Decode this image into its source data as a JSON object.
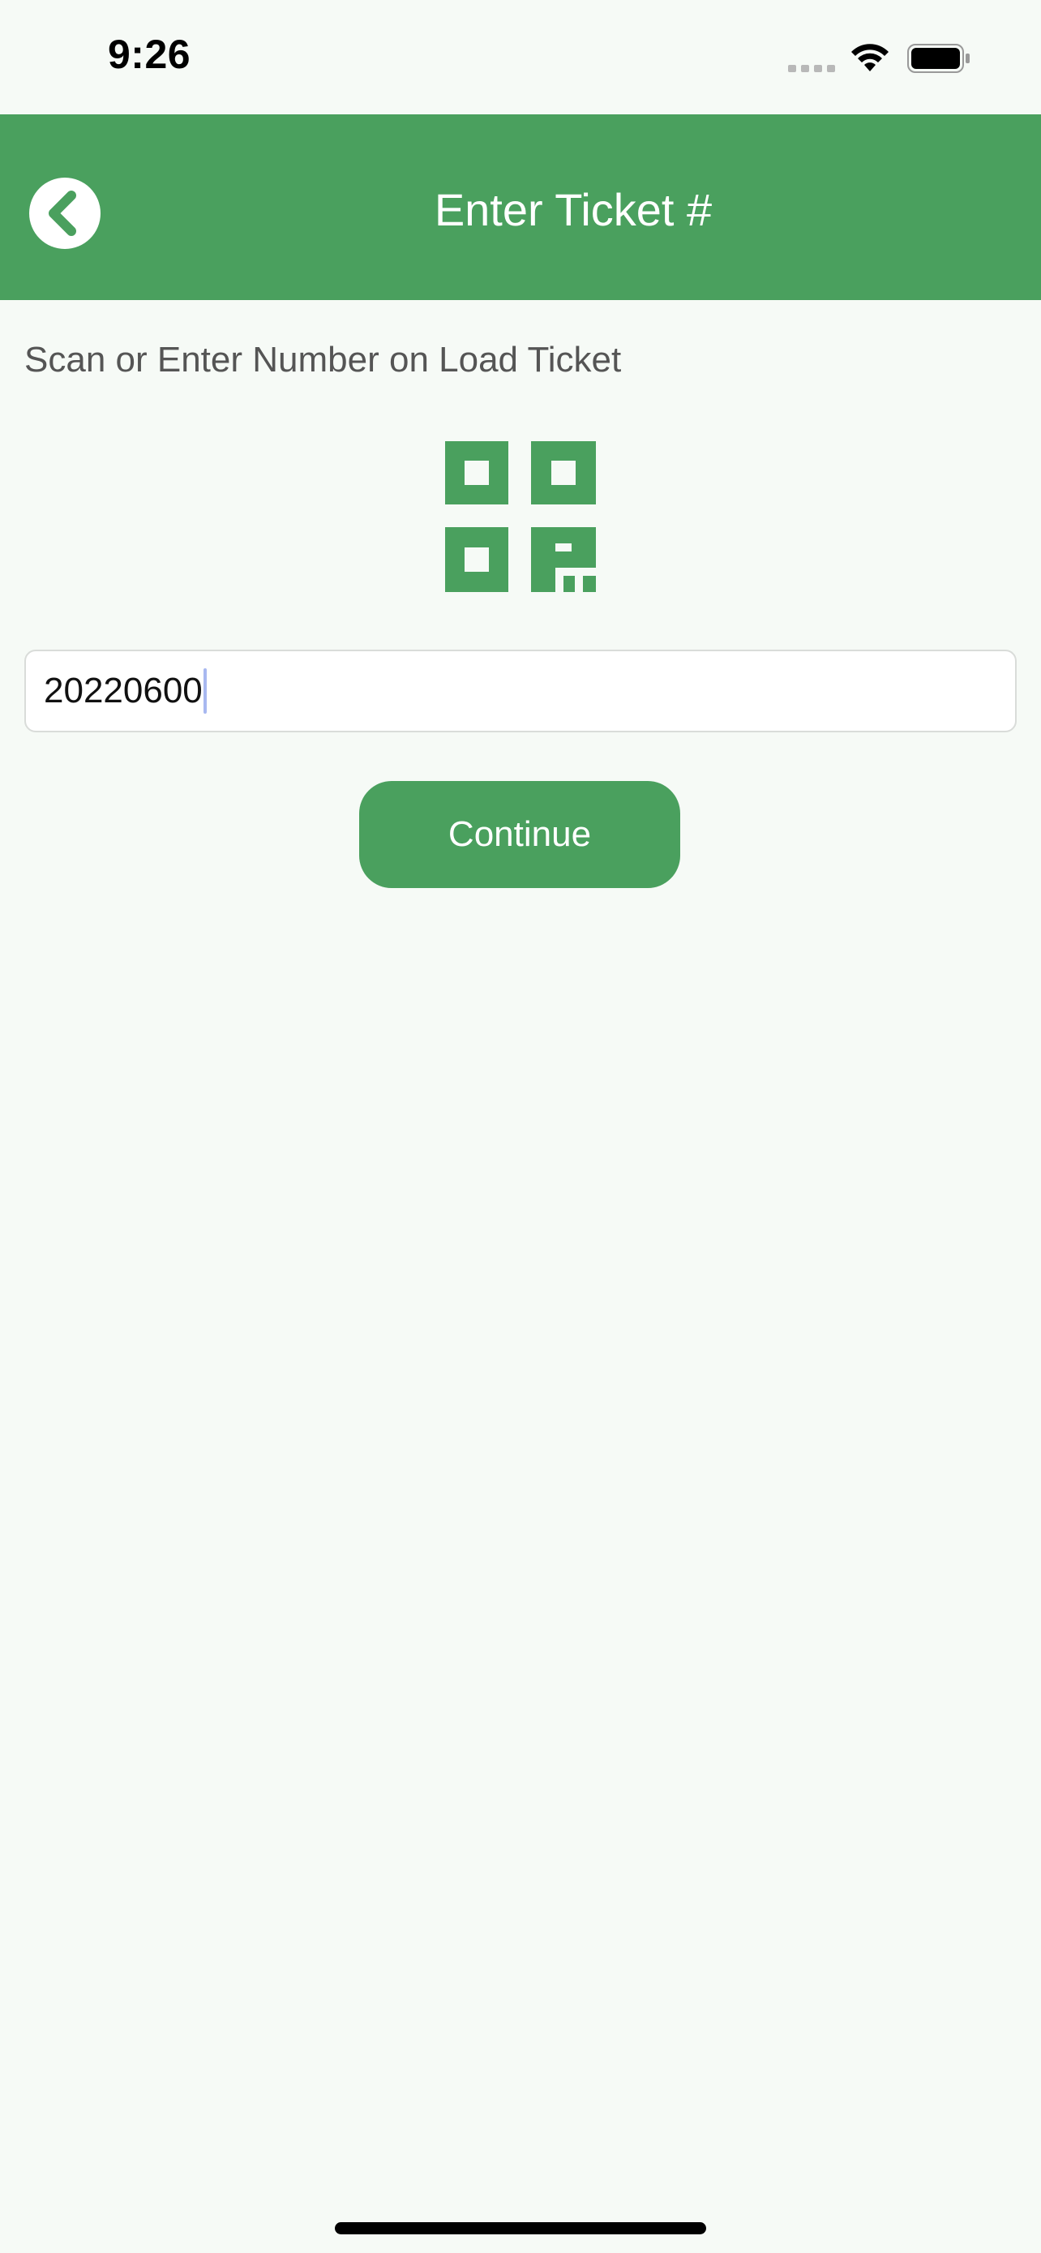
{
  "status_bar": {
    "time": "9:26"
  },
  "header": {
    "title": "Enter Ticket #",
    "background_color": "#4aa05e"
  },
  "content": {
    "instruction": "Scan or Enter Number on Load Ticket",
    "ticket_input": {
      "value": "20220600"
    },
    "continue_label": "Continue"
  },
  "icons": {
    "back": "chevron-left-icon",
    "scan": "qr-code-icon",
    "wifi": "wifi-icon",
    "battery": "battery-icon",
    "signal": "cellular-signal-icon"
  },
  "colors": {
    "accent": "#4aa05e",
    "background": "#f6faf6",
    "text_secondary": "#555555"
  }
}
